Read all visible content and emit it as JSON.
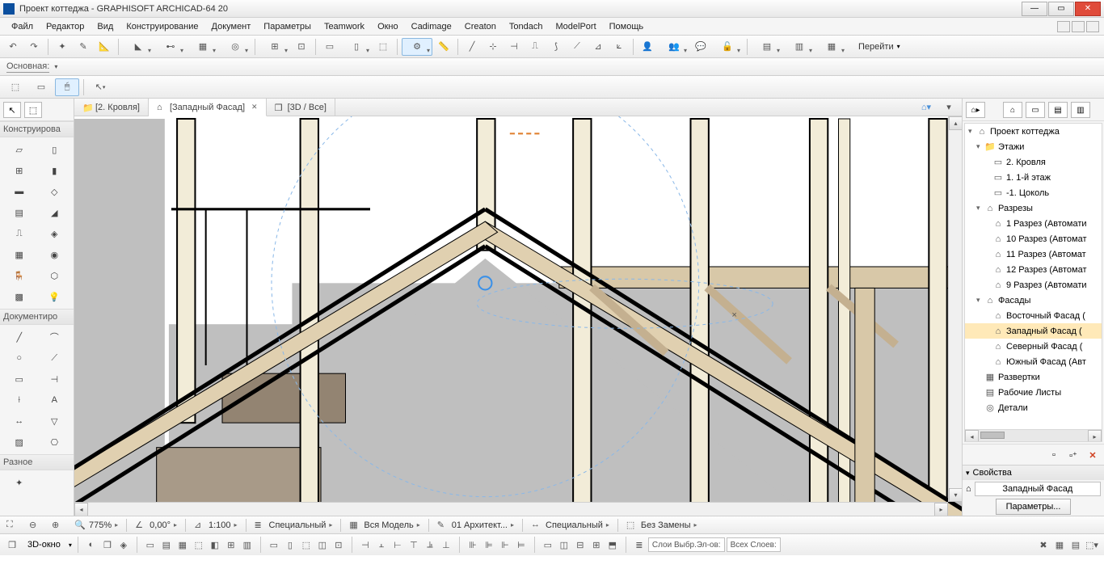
{
  "title": "Проект коттеджа - GRAPHISOFT ARCHICAD-64 20",
  "menus": [
    "Файл",
    "Редактор",
    "Вид",
    "Конструирование",
    "Документ",
    "Параметры",
    "Teamwork",
    "Окно",
    "Cadimage",
    "Creaton",
    "Tondach",
    "ModelPort",
    "Помощь"
  ],
  "navigate_label": "Перейти",
  "layer_label": "Основная:",
  "tabs": [
    {
      "label": "[2. Кровля]",
      "icon": "📁",
      "active": false
    },
    {
      "label": "[Западный Фасад]",
      "icon": "⌂",
      "active": true
    },
    {
      "label": "[3D / Все]",
      "icon": "❒",
      "active": false
    }
  ],
  "toolbox": {
    "section_construct": "Конструирова",
    "section_document": "Документиро",
    "section_misc": "Разное"
  },
  "navigator": {
    "project": "Проект коттеджа",
    "stories_label": "Этажи",
    "stories": [
      "2. Кровля",
      "1. 1-й этаж",
      "-1. Цоколь"
    ],
    "sections_label": "Разрезы",
    "sections": [
      "1 Разрез (Автомати",
      "10 Разрез (Автомат",
      "11 Разрез (Автомат",
      "12 Разрез (Автомат",
      "9 Разрез (Автомати"
    ],
    "elevations_label": "Фасады",
    "elevations": [
      "Восточный Фасад (",
      "Западный Фасад (",
      "Северный Фасад (",
      "Южный Фасад (Авт"
    ],
    "elevation_selected": 1,
    "interior_label": "Развертки",
    "worksheets_label": "Рабочие Листы",
    "details_label": "Детали"
  },
  "properties": {
    "header": "Свойства",
    "value": "Западный Фасад",
    "button": "Параметры..."
  },
  "status": {
    "zoom": "775%",
    "angle": "0,00°",
    "scale": "1:100",
    "group1": "Специальный",
    "group2": "Вся Модель",
    "group3": "01  Архитект...",
    "group4": "Специальный",
    "group5": "Без Замены",
    "window3d": "3D-окно",
    "layer1": "Слои Выбр.Эл-ов:",
    "layer2": "Всех Слоев:"
  }
}
